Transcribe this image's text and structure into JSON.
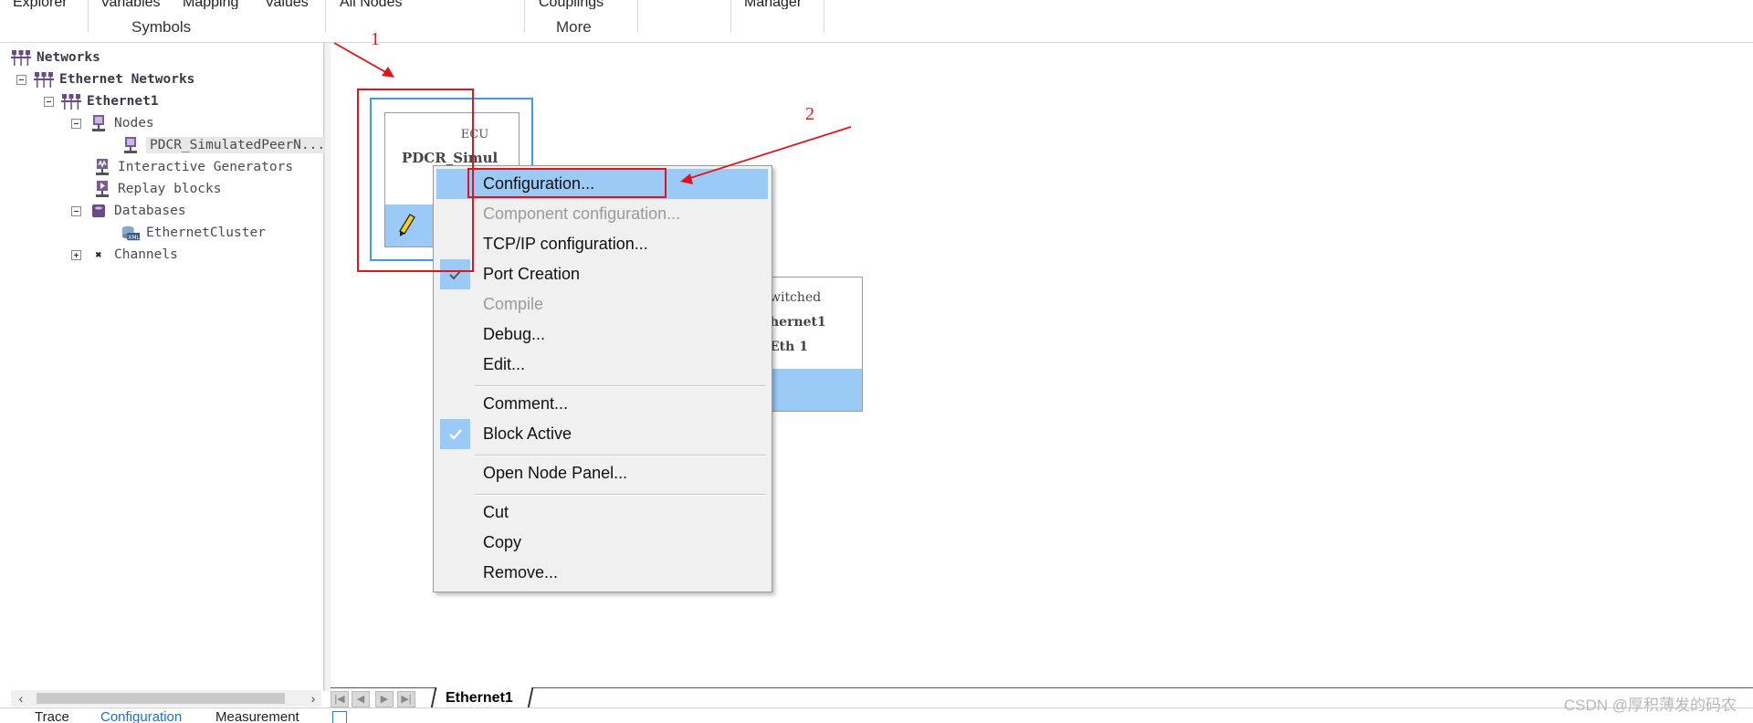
{
  "ribbon": {
    "top_labels": [
      "Explorer",
      "Variables",
      "Mapping",
      "Values",
      "All Nodes",
      "Couplings",
      "Manager"
    ],
    "groups": {
      "symbols": "Symbols",
      "more": "More"
    }
  },
  "tree": {
    "root": "Networks",
    "ethernet_networks": "Ethernet Networks",
    "ethernet1": "Ethernet1",
    "nodes": "Nodes",
    "node_item": "PDCR_SimulatedPeerN...",
    "interactive_generators": "Interactive Generators",
    "replay_blocks": "Replay blocks",
    "databases": "Databases",
    "db_item": "EthernetCluster",
    "channels": "Channels"
  },
  "canvas": {
    "ecu_node": {
      "type": "ECU",
      "name": "PDCR_Simul"
    },
    "switch_node": {
      "line1": "witched",
      "line2": "hernet1",
      "line3": "Eth 1"
    }
  },
  "context_menu": {
    "items": [
      {
        "label": "Configuration...",
        "highlighted": true
      },
      {
        "label": "Component configuration...",
        "disabled": true
      },
      {
        "label": "TCP/IP configuration..."
      },
      {
        "label": "Port Creation",
        "checked": true
      },
      {
        "label": "Compile",
        "disabled": true
      },
      {
        "label": "Debug..."
      },
      {
        "label": "Edit..."
      },
      {
        "label": "Comment..."
      },
      {
        "label": "Block Active",
        "checked": true
      },
      {
        "label": "Open Node Panel..."
      },
      {
        "label": "Cut"
      },
      {
        "label": "Copy"
      },
      {
        "label": "Remove..."
      }
    ]
  },
  "annotations": {
    "step1": "1",
    "step2": "2",
    "color": "#e2141b"
  },
  "sheet_tab": "Ethernet1",
  "bottom_tabs": [
    "Trace",
    "Configuration",
    "Measurement"
  ],
  "watermark": "CSDN @厚积薄发的码农",
  "colors": {
    "highlight": "#9ccaf6",
    "selection_border": "#3d9bf0",
    "active_tab": "#1d6fc8"
  }
}
